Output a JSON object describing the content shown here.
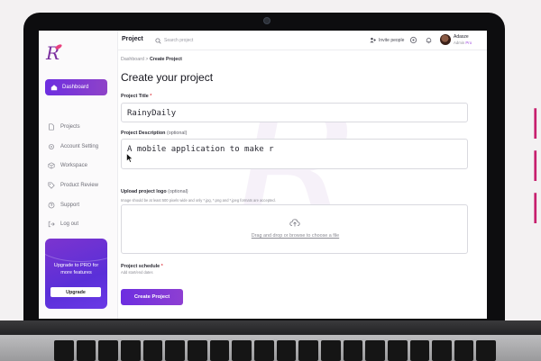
{
  "sidebar": {
    "active_item": "Dashboard",
    "items": [
      {
        "label": "Projects",
        "icon": "file-icon"
      },
      {
        "label": "Account Setting",
        "icon": "gear-icon"
      },
      {
        "label": "Workspace",
        "icon": "cube-icon"
      },
      {
        "label": "Product Review",
        "icon": "tag-icon"
      },
      {
        "label": "Support",
        "icon": "help-icon"
      },
      {
        "label": "Log out",
        "icon": "logout-icon"
      }
    ],
    "upgrade": {
      "text": "Upgrade to PRO for more features",
      "button": "Upgrade"
    }
  },
  "topbar": {
    "title": "Project",
    "search_placeholder": "Search project",
    "invite_label": "Invite people",
    "user_name": "Adasze",
    "user_role_prefix": "Admin",
    "user_plan": "Pro"
  },
  "main": {
    "breadcrumb": {
      "parent": "Dashboard",
      "separator": ">",
      "current": "Create Project"
    },
    "title": "Create your project",
    "project_title": {
      "label": "Project Title",
      "required_mark": "*",
      "value": "RainyDaily"
    },
    "project_description": {
      "label": "Project Description",
      "optional": "(optional)",
      "value": "A mobile application to make r"
    },
    "upload": {
      "label": "Upload project logo",
      "optional": "(optional)",
      "hint": "Image should be at least 500 pixels wide and only *.jpg, *.png and *.jpeg formats are accepted.",
      "link_text": "Drag and drop or browse to choose a file"
    },
    "schedule": {
      "label": "Project schedule",
      "required_mark": "*",
      "hint": "Add start/end dates"
    },
    "submit_label": "Create Project"
  },
  "colors": {
    "accent": "#6d2ee0",
    "accent_secondary": "#8f43c8",
    "required": "#e0434b",
    "promo": "#c7206f"
  }
}
